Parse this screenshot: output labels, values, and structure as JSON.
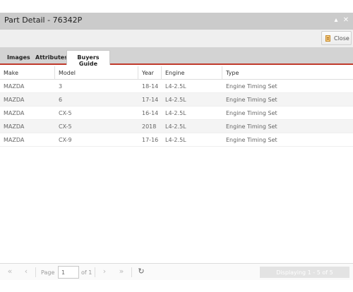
{
  "window": {
    "title": "Part Detail - 76342P",
    "minimize_glyph": "▴",
    "close_glyph": "✕"
  },
  "toolbar": {
    "close_label": "Close",
    "close_icon": "document-icon"
  },
  "tabs": [
    {
      "label": "Images",
      "active": false
    },
    {
      "label": "Attributes",
      "active": false
    },
    {
      "label": "Buyers Guide",
      "active": true
    }
  ],
  "grid": {
    "columns": [
      "Make",
      "Model",
      "Year",
      "Engine",
      "Type"
    ],
    "rows": [
      [
        "MAZDA",
        "3",
        "18-14",
        "L4-2.5L",
        "Engine Timing Set"
      ],
      [
        "MAZDA",
        "6",
        "17-14",
        "L4-2.5L",
        "Engine Timing Set"
      ],
      [
        "MAZDA",
        "CX-5",
        "16-14",
        "L4-2.5L",
        "Engine Timing Set"
      ],
      [
        "MAZDA",
        "CX-5",
        "2018",
        "L4-2.5L",
        "Engine Timing Set"
      ],
      [
        "MAZDA",
        "CX-9",
        "17-16",
        "L4-2.5L",
        "Engine Timing Set"
      ]
    ]
  },
  "pager": {
    "page_label": "Page",
    "page_value": "1",
    "of_label": "of 1",
    "status": "Displaying 1 - 5 of 5",
    "first_glyph": "«",
    "prev_glyph": "‹",
    "next_glyph": "›",
    "last_glyph": "»",
    "refresh_glyph": "↻"
  },
  "colors": {
    "titlebar": "#cbcbcb",
    "tab_accent": "#c0392b",
    "alt_row": "#f4f4f4"
  }
}
